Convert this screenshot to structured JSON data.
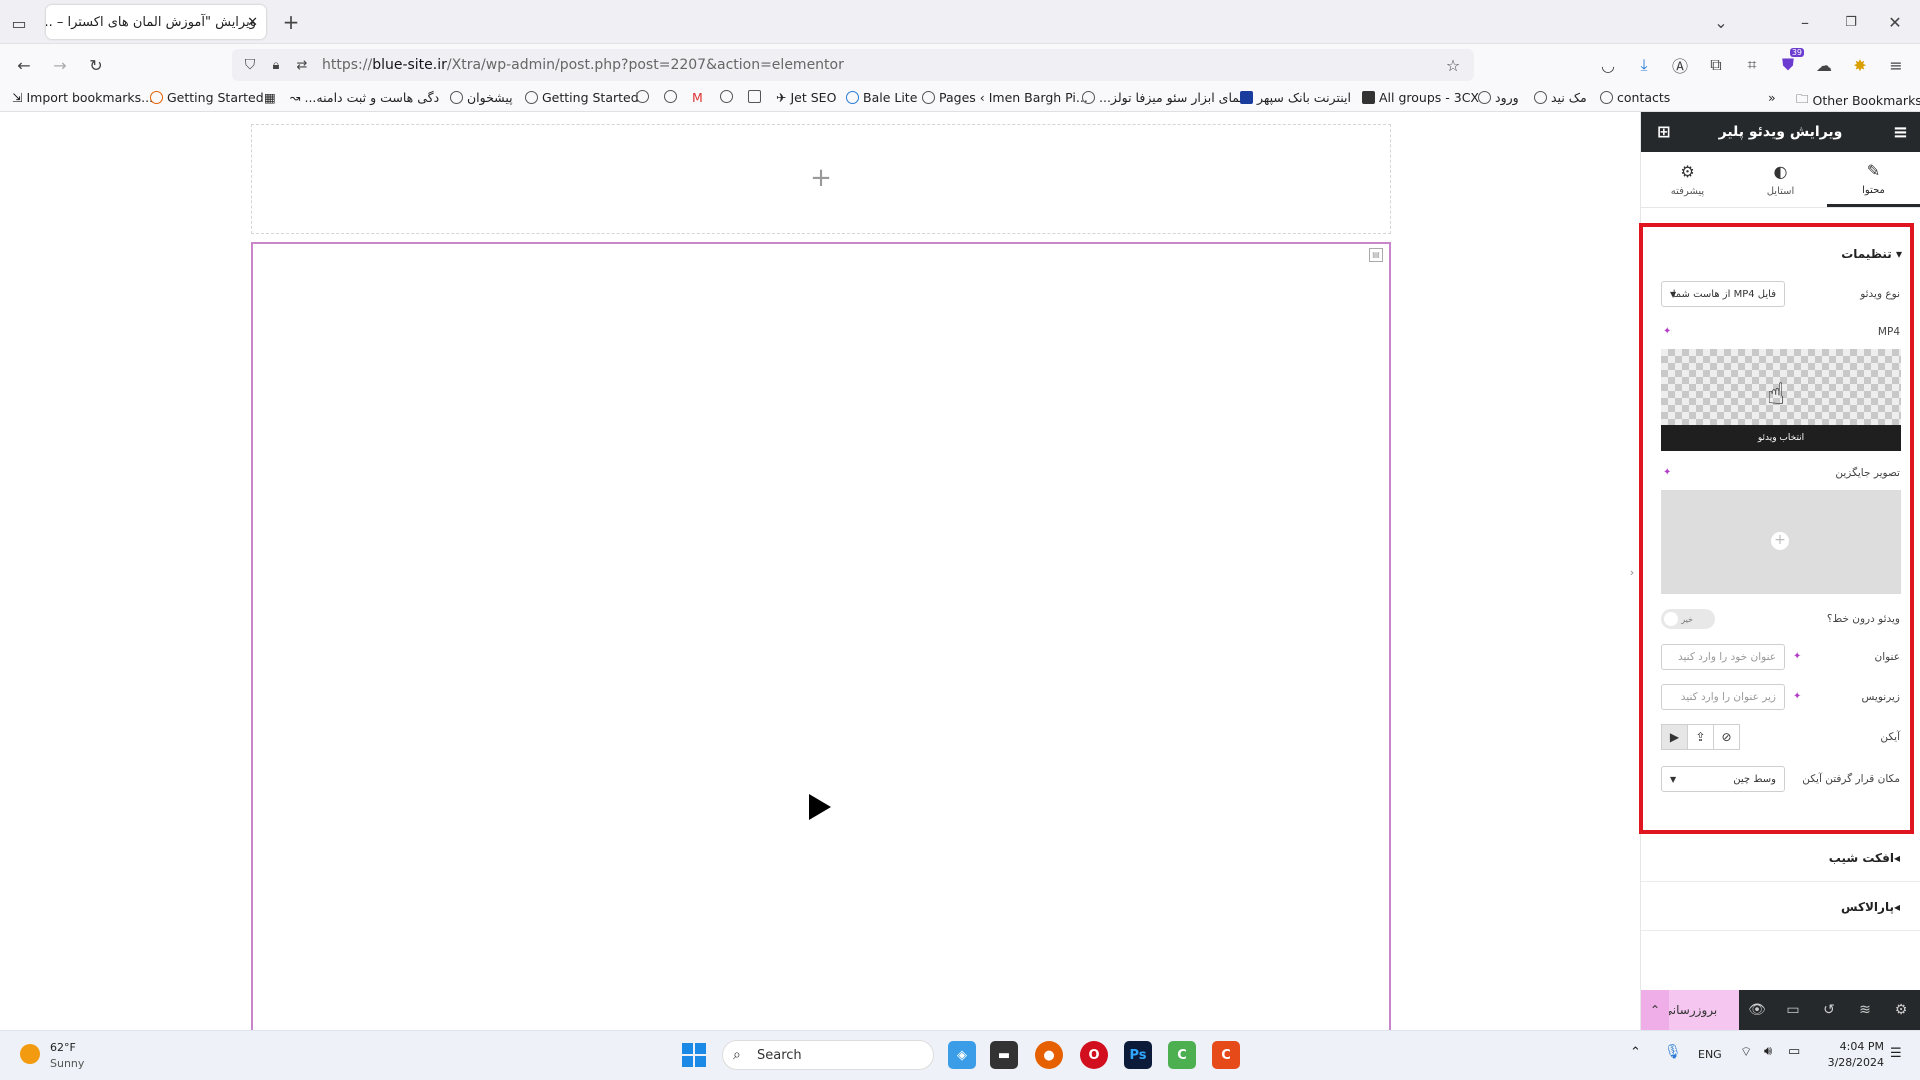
{
  "browser": {
    "tab_title": "ویرایش \"آموزش المان های اکسترا – ...",
    "tab_close": "✕",
    "new_tab": "+",
    "url_prefix": "https://",
    "url_domain": "blue-site.ir",
    "url_path": "/Xtra/wp-admin/post.php?post=2207&action=elementor",
    "extension_badge": "39"
  },
  "bookmarks": [
    "Import bookmarks...",
    "Getting Started",
    "...دگی هاست و ثبت دامنه",
    "پیشخوان",
    "Getting Started",
    "Jet SEO",
    "Bale Lite",
    "Pages ‹ Imen Bargh Pi...",
    "...نمای ابزار سئو میزفا تولز",
    "اینترنت بانک سپهر",
    "All groups - 3CX",
    "ورود",
    "مک نید",
    "contacts"
  ],
  "other_bookmarks": "Other Bookmarks",
  "canvas": {
    "add_section": "+"
  },
  "panel": {
    "title": "ویرایش ویدئو پلیر",
    "tabs": [
      {
        "label": "محتوا",
        "icon": "pencil-icon"
      },
      {
        "label": "استایل",
        "icon": "contrast-icon"
      },
      {
        "label": "پیشرفته",
        "icon": "gear-icon"
      }
    ],
    "section_title": "تنظیمات",
    "video_type_label": "نوع ویدئو",
    "video_type_value": "فایل MP4 از هاست شما",
    "mp4_label": "MP4",
    "choose_video": "انتخاب ویدئو",
    "placeholder_image_label": "تصویر جایگزین",
    "add_image": "+",
    "inline_label": "ویدئو درون خط؟",
    "inline_toggle": "خیر",
    "title_label": "عنوان",
    "title_placeholder": "عنوان خود را وارد کنید",
    "subtitle_label": "زیرنویس",
    "subtitle_placeholder": "زیر عنوان را وارد کنید",
    "icon_label": "آیکن",
    "icon_position_label": "مکان قرار گرفتن آیکن",
    "icon_position_value": "وسط چین",
    "accordion_1": "افکت شیب",
    "accordion_2": "پارالاکس",
    "publish": "بروزرسانی"
  },
  "taskbar": {
    "weather_temp": "62°F",
    "weather_desc": "Sunny",
    "search": "Search",
    "lang": "ENG",
    "time": "4:04 PM",
    "date": "3/28/2024"
  },
  "colors": {
    "panel_dark": "#26292c",
    "highlight_red": "#e0151f",
    "selection_pink": "#c985c9",
    "publish_pink": "#f4c6f0"
  }
}
